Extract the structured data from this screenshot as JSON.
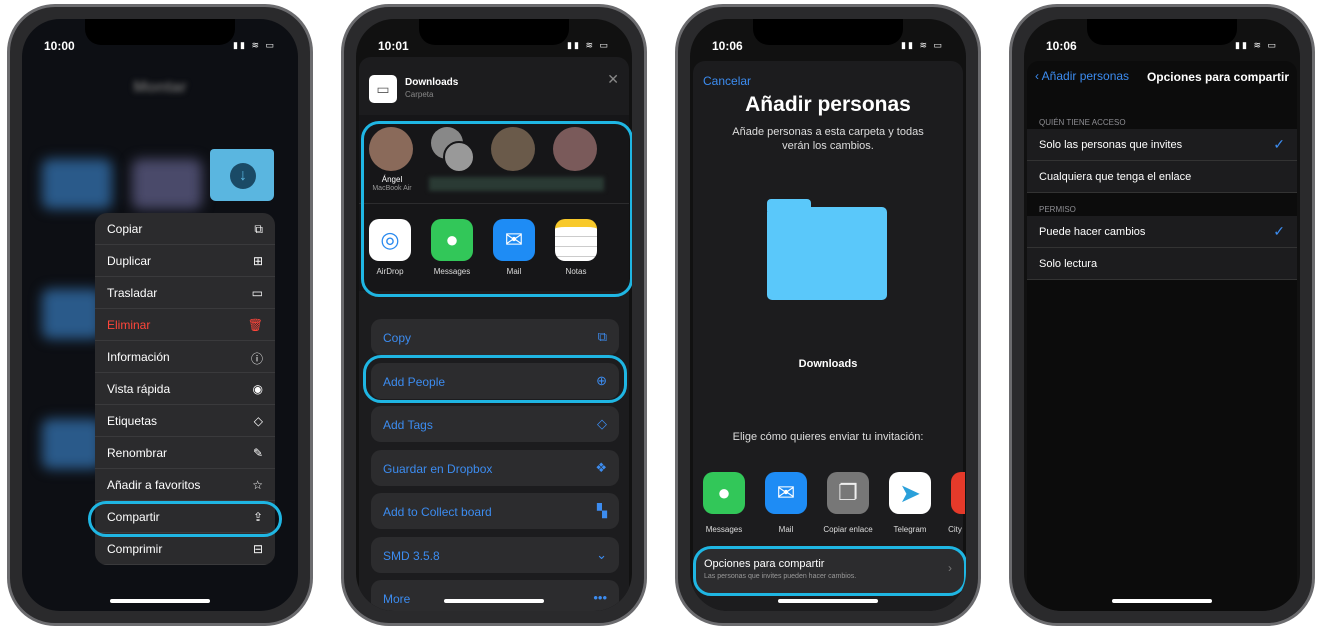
{
  "phone1": {
    "time": "10:00",
    "blurred_title": "Montar",
    "menu": [
      {
        "label": "Copiar",
        "icon": "copy-icon",
        "glyph": "⧉"
      },
      {
        "label": "Duplicar",
        "icon": "duplicate-icon",
        "glyph": "⊞"
      },
      {
        "label": "Trasladar",
        "icon": "folder-icon",
        "glyph": "▭"
      },
      {
        "label": "Eliminar",
        "icon": "trash-icon",
        "glyph": "🗑",
        "destructive": true
      },
      {
        "label": "Información",
        "icon": "info-icon",
        "glyph": "ⓘ"
      },
      {
        "label": "Vista rápida",
        "icon": "eye-icon",
        "glyph": "◉"
      },
      {
        "label": "Etiquetas",
        "icon": "tag-icon",
        "glyph": "◇"
      },
      {
        "label": "Renombrar",
        "icon": "edit-icon",
        "glyph": "✎"
      },
      {
        "label": "Añadir a favoritos",
        "icon": "star-icon",
        "glyph": "☆"
      },
      {
        "label": "Compartir",
        "icon": "share-icon",
        "glyph": "⇪",
        "highlighted": true
      },
      {
        "label": "Comprimir",
        "icon": "archive-icon",
        "glyph": "⊟"
      }
    ]
  },
  "phone2": {
    "time": "10:01",
    "title": "Downloads",
    "subtitle": "Carpeta",
    "close": "✕",
    "person": {
      "name": "Ángel",
      "device": "MacBook Air"
    },
    "apps": [
      "AirDrop",
      "Messages",
      "Mail",
      "Notas"
    ],
    "actions": [
      {
        "label": "Copy",
        "glyph": "⧉"
      },
      {
        "label": "Add People",
        "glyph": "⊕",
        "highlighted": true
      },
      {
        "label": "Add Tags",
        "glyph": "◇"
      },
      {
        "label": "Guardar en Dropbox",
        "glyph": "❖"
      },
      {
        "label": "Add to Collect board",
        "glyph": "▚"
      },
      {
        "label": "SMD 3.5.8",
        "glyph": "⌄"
      },
      {
        "label": "More",
        "glyph": "•••"
      }
    ]
  },
  "phone3": {
    "time": "10:06",
    "cancel": "Cancelar",
    "title": "Añadir personas",
    "subtitle": "Añade personas a esta carpeta y todas verán los cambios.",
    "folder_name": "Downloads",
    "prompt": "Elige cómo quieres enviar tu invitación:",
    "apps": [
      "Messages",
      "Mail",
      "Copiar enlace",
      "Telegram",
      "City"
    ],
    "options": {
      "title": "Opciones para compartir",
      "subtitle": "Las personas que invites pueden hacer cambios."
    }
  },
  "phone4": {
    "time": "10:06",
    "back": "Añadir personas",
    "title": "Opciones para compartir",
    "access_header": "QUIÉN TIENE ACCESO",
    "access": [
      {
        "label": "Solo las personas que invites",
        "checked": true
      },
      {
        "label": "Cualquiera que tenga el enlace",
        "checked": false
      }
    ],
    "permission_header": "PERMISO",
    "permission": [
      {
        "label": "Puede hacer cambios",
        "checked": true
      },
      {
        "label": "Solo lectura",
        "checked": false
      }
    ]
  },
  "colors": {
    "accent": "#1fb6e3",
    "link": "#3c8cf0",
    "destructive": "#ff453a"
  }
}
